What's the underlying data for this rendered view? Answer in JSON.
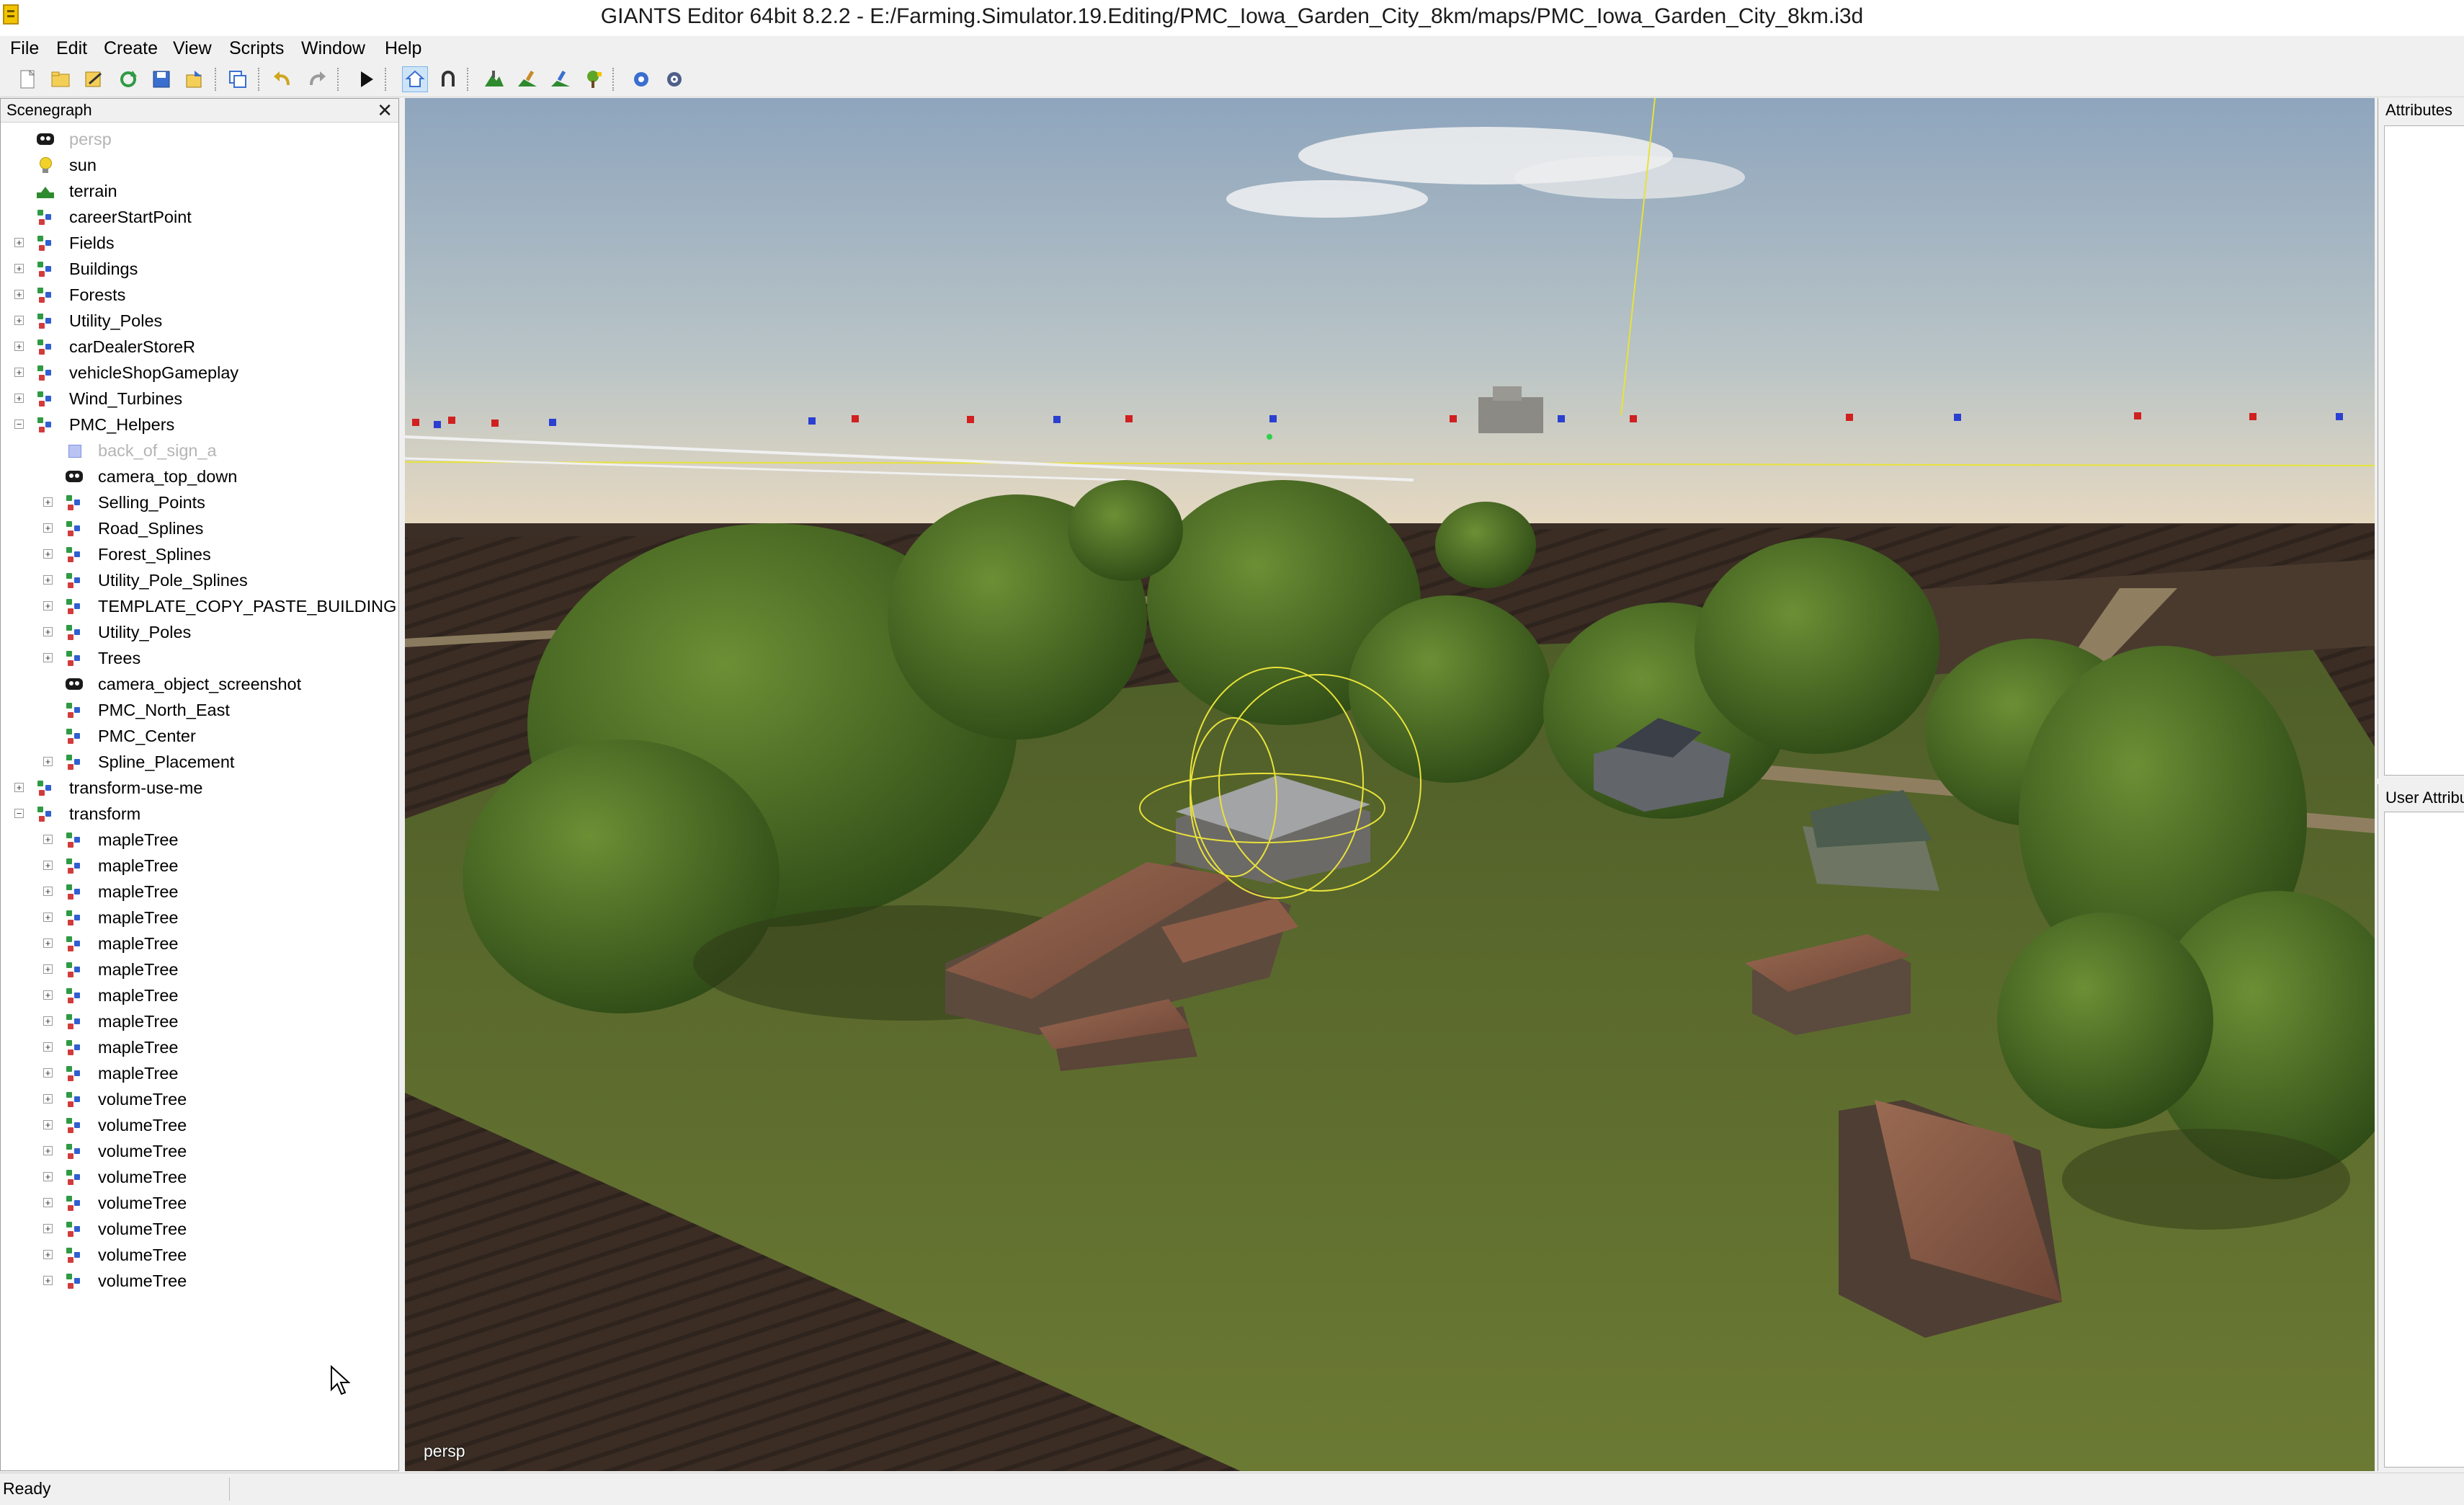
{
  "window": {
    "title": "GIANTS Editor 64bit 8.2.2 - E:/Farming.Simulator.19.Editing/PMC_Iowa_Garden_City_8km/maps/PMC_Iowa_Garden_City_8km.i3d"
  },
  "menu": [
    {
      "label": "File"
    },
    {
      "label": "Edit"
    },
    {
      "label": "Create"
    },
    {
      "label": "View"
    },
    {
      "label": "Scripts"
    },
    {
      "label": "Window"
    },
    {
      "label": "Help"
    }
  ],
  "toolbar": {
    "buttons": [
      "new-file",
      "open-file",
      "save-as",
      "reload",
      "save",
      "export",
      "clone",
      "undo",
      "redo",
      "play",
      "move-camera",
      "magnet",
      "terrain-sculpt",
      "terrain-paint",
      "foliage-paint",
      "tree-place",
      "settings",
      "refresh-settings"
    ]
  },
  "scenegraph": {
    "title": "Scenegraph",
    "close": "✕",
    "nodes": [
      {
        "label": "persp",
        "icon": "camera-icon",
        "level": 0,
        "expand": "",
        "dim": true
      },
      {
        "label": "sun",
        "icon": "light-bulb-icon",
        "level": 0,
        "expand": ""
      },
      {
        "label": "terrain",
        "icon": "terrain-icon",
        "level": 0,
        "expand": ""
      },
      {
        "label": "careerStartPoint",
        "icon": "transform-group-icon",
        "level": 0,
        "expand": ""
      },
      {
        "label": "Fields",
        "icon": "transform-group-icon",
        "level": 0,
        "expand": "+"
      },
      {
        "label": "Buildings",
        "icon": "transform-group-icon",
        "level": 0,
        "expand": "+"
      },
      {
        "label": "Forests",
        "icon": "transform-group-icon",
        "level": 0,
        "expand": "+"
      },
      {
        "label": "Utility_Poles",
        "icon": "transform-group-icon",
        "level": 0,
        "expand": "+"
      },
      {
        "label": "carDealerStoreR",
        "icon": "transform-group-icon",
        "level": 0,
        "expand": "+"
      },
      {
        "label": "vehicleShopGameplay",
        "icon": "transform-group-icon",
        "level": 0,
        "expand": "+"
      },
      {
        "label": "Wind_Turbines",
        "icon": "transform-group-icon",
        "level": 0,
        "expand": "+"
      },
      {
        "label": "PMC_Helpers",
        "icon": "transform-group-icon",
        "level": 0,
        "expand": "−"
      },
      {
        "label": "back_of_sign_a",
        "icon": "shape-icon",
        "level": 1,
        "expand": "",
        "dim": true
      },
      {
        "label": "camera_top_down",
        "icon": "camera-icon",
        "level": 1,
        "expand": ""
      },
      {
        "label": "Selling_Points",
        "icon": "transform-group-icon",
        "level": 1,
        "expand": "+"
      },
      {
        "label": "Road_Splines",
        "icon": "transform-group-icon",
        "level": 1,
        "expand": "+"
      },
      {
        "label": "Forest_Splines",
        "icon": "transform-group-icon",
        "level": 1,
        "expand": "+"
      },
      {
        "label": "Utility_Pole_Splines",
        "icon": "transform-group-icon",
        "level": 1,
        "expand": "+"
      },
      {
        "label": "TEMPLATE_COPY_PASTE_BUILDING",
        "icon": "transform-group-icon",
        "level": 1,
        "expand": "+"
      },
      {
        "label": "Utility_Poles",
        "icon": "transform-group-icon",
        "level": 1,
        "expand": "+"
      },
      {
        "label": "Trees",
        "icon": "transform-group-icon",
        "level": 1,
        "expand": "+"
      },
      {
        "label": "camera_object_screenshot",
        "icon": "camera-icon",
        "level": 1,
        "expand": ""
      },
      {
        "label": "PMC_North_East",
        "icon": "transform-group-icon",
        "level": 1,
        "expand": ""
      },
      {
        "label": "PMC_Center",
        "icon": "transform-group-icon",
        "level": 1,
        "expand": ""
      },
      {
        "label": "Spline_Placement",
        "icon": "transform-group-icon",
        "level": 1,
        "expand": "+"
      },
      {
        "label": "transform-use-me",
        "icon": "transform-group-icon",
        "level": 0,
        "expand": "+"
      },
      {
        "label": "transform",
        "icon": "transform-group-icon",
        "level": 0,
        "expand": "−"
      },
      {
        "label": "mapleTree",
        "icon": "transform-group-icon",
        "level": 1,
        "expand": "+"
      },
      {
        "label": "mapleTree",
        "icon": "transform-group-icon",
        "level": 1,
        "expand": "+"
      },
      {
        "label": "mapleTree",
        "icon": "transform-group-icon",
        "level": 1,
        "expand": "+"
      },
      {
        "label": "mapleTree",
        "icon": "transform-group-icon",
        "level": 1,
        "expand": "+"
      },
      {
        "label": "mapleTree",
        "icon": "transform-group-icon",
        "level": 1,
        "expand": "+"
      },
      {
        "label": "mapleTree",
        "icon": "transform-group-icon",
        "level": 1,
        "expand": "+"
      },
      {
        "label": "mapleTree",
        "icon": "transform-group-icon",
        "level": 1,
        "expand": "+"
      },
      {
        "label": "mapleTree",
        "icon": "transform-group-icon",
        "level": 1,
        "expand": "+"
      },
      {
        "label": "mapleTree",
        "icon": "transform-group-icon",
        "level": 1,
        "expand": "+"
      },
      {
        "label": "mapleTree",
        "icon": "transform-group-icon",
        "level": 1,
        "expand": "+"
      },
      {
        "label": "volumeTree",
        "icon": "transform-group-icon",
        "level": 1,
        "expand": "+"
      },
      {
        "label": "volumeTree",
        "icon": "transform-group-icon",
        "level": 1,
        "expand": "+"
      },
      {
        "label": "volumeTree",
        "icon": "transform-group-icon",
        "level": 1,
        "expand": "+"
      },
      {
        "label": "volumeTree",
        "icon": "transform-group-icon",
        "level": 1,
        "expand": "+"
      },
      {
        "label": "volumeTree",
        "icon": "transform-group-icon",
        "level": 1,
        "expand": "+"
      },
      {
        "label": "volumeTree",
        "icon": "transform-group-icon",
        "level": 1,
        "expand": "+"
      },
      {
        "label": "volumeTree",
        "icon": "transform-group-icon",
        "level": 1,
        "expand": "+"
      },
      {
        "label": "volumeTree",
        "icon": "transform-group-icon",
        "level": 1,
        "expand": "+"
      }
    ]
  },
  "viewport": {
    "camera_label": "persp"
  },
  "attributes": {
    "title": "Attributes"
  },
  "user_attributes": {
    "title": "User Attributes"
  },
  "status": {
    "text": "Ready"
  },
  "colors": {
    "sky_top": "#8fa6be",
    "sky_horizon": "#e6d8bf",
    "grass": "#5f6e2c",
    "field": "#3a2c22",
    "tree": "#3d5a1e",
    "roof": "#8b5a45",
    "gizmo": "#e8e23a"
  }
}
